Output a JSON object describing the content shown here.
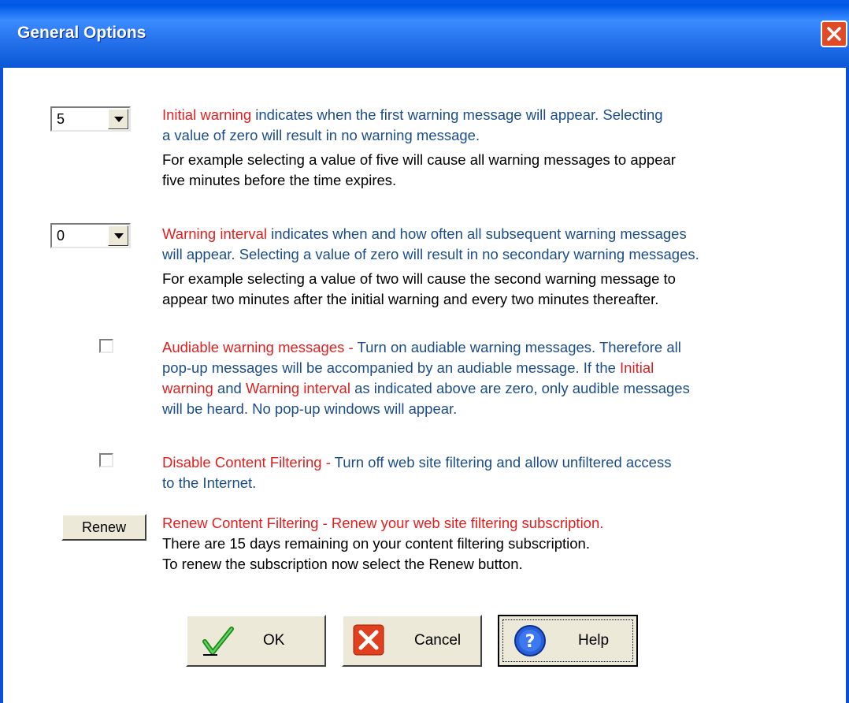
{
  "window": {
    "title": "General Options"
  },
  "initial_warning": {
    "selected_value": "5",
    "line1_red": "Initial warning",
    "line1_rest": " indicates  when  the  first warning  message will appear. Selecting",
    "line2": "a value of zero will result in no warning message.",
    "line3": "For example selecting a value of five will cause all warning messages to appear",
    "line4": "five minutes before the time expires."
  },
  "warning_interval": {
    "selected_value": "0",
    "line1_red": "Warning interval",
    "line1_rest": " indicates when and how often all subsequent warning messages",
    "line2": "will appear. Selecting a value of zero will result in no secondary warning messages.",
    "line3": "For example selecting a value of two will cause the second warning message to",
    "line4": "appear two minutes after the initial warning and every two minutes thereafter."
  },
  "audible": {
    "checked": false,
    "line1_red": "Audiable warning messages -",
    "line1_rest": " Turn on audiable warning messages. Therefore all",
    "line2_blue": "pop-up messages will be accompanied by an audiable message. If the ",
    "line2_red": "Initial",
    "line3_red1": "warning",
    "line3_and": " and ",
    "line3_red2": "Warning interval",
    "line3_rest": " as indicated above are zero, only audible messages",
    "line4": "will be heard. No pop-up windows will appear."
  },
  "disable_filtering": {
    "checked": false,
    "line1_red": "Disable Content Filtering -",
    "line1_rest": " Turn off web site filtering and allow unfiltered access",
    "line2": "to the Internet."
  },
  "renew": {
    "button_label": "Renew",
    "line1": "Renew Content Filtering - Renew your web site filtering subscription.",
    "line2": "There are 15 days remaining on your content filtering subscription.",
    "line3": "To renew the subscription now select the Renew button."
  },
  "buttons": {
    "ok": "OK",
    "cancel": "Cancel",
    "help": "Help"
  },
  "icons": {
    "close": "close-icon",
    "dropdown": "chevron-down-icon",
    "ok": "checkmark-icon",
    "cancel": "x-icon",
    "help": "question-icon"
  },
  "colors": {
    "titlebar": "#0058e6",
    "highlight": "#e02020",
    "text_blue": "#1b4d8a",
    "button_face": "#ece9d8"
  }
}
